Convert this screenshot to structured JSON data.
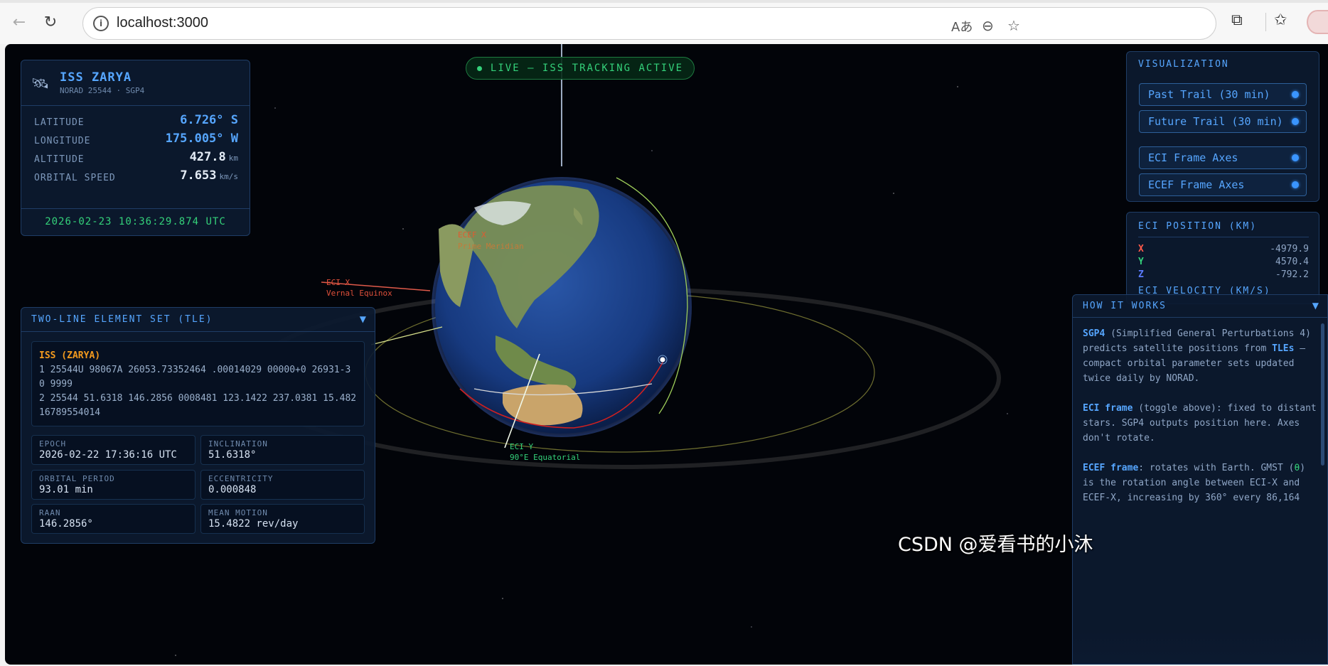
{
  "browser": {
    "url": "localhost:3000",
    "icons": [
      "back-icon",
      "reload-icon",
      "info-icon",
      "read-aloud-icon",
      "zoom-out-icon",
      "favorite-star-icon",
      "extensions-icon",
      "favorites-icon",
      "profile-avatar"
    ]
  },
  "iss": {
    "name": "ISS ZARYA",
    "subtitle": "NORAD 25544 · SGP4",
    "latitude_label": "LATITUDE",
    "latitude_value": "6.726° S",
    "longitude_label": "LONGITUDE",
    "longitude_value": "175.005° W",
    "altitude_label": "ALTITUDE",
    "altitude_value": "427.8",
    "altitude_unit": "km",
    "speed_label": "ORBITAL SPEED",
    "speed_value": "7.653",
    "speed_unit": "km/s",
    "timestamp": "2026-02-23 10:36:29.874 UTC",
    "colors": {
      "latlon": "#56a6ff",
      "plain": "#e4ecf6",
      "time": "#34d17a"
    }
  },
  "live_badge": "LIVE — ISS TRACKING ACTIVE",
  "scene_labels": {
    "ecef_x": "ECEF X",
    "ecef_x_sub": "Prime Meridian",
    "eci_x": "ECI X",
    "eci_x_sub": "Vernal Equinox",
    "eci_y": "ECI Y",
    "eci_y_sub": "90°E Equatorial"
  },
  "visualization": {
    "title": "VISUALIZATION",
    "toggles": [
      {
        "label": "Past Trail (30 min)",
        "on": true
      },
      {
        "label": "Future Trail (30 min)",
        "on": true
      },
      {
        "label": "ECI Frame Axes",
        "on": true
      },
      {
        "label": "ECEF Frame Axes",
        "on": true
      }
    ]
  },
  "eci_position": {
    "title": "ECI POSITION (KM)",
    "rows": [
      {
        "axis": "X",
        "value": "-4979.9",
        "color": "#ff5a4a"
      },
      {
        "axis": "Y",
        "value": "4570.4",
        "color": "#34d17a"
      },
      {
        "axis": "Z",
        "value": "-792.2",
        "color": "#5b7cff"
      }
    ],
    "velocity_title": "ECI VELOCITY (KM/S)"
  },
  "how_it_works": {
    "title": "HOW IT WORKS",
    "p1_kw": "SGP4",
    "p1_a": " (Simplified General Perturbations 4) predicts satellite positions from ",
    "p1_kw2": "TLEs",
    "p1_b": " — compact orbital parameter sets updated twice daily by NORAD.",
    "p2_kw": "ECI frame",
    "p2_a": " (toggle above): fixed to distant stars. SGP4 outputs position here. Axes don't rotate.",
    "p3_kw": "ECEF frame",
    "p3_a": ": rotates with Earth. GMST (",
    "p3_theta": "θ",
    "p3_b": ") is the rotation angle between ECI-X and ECEF-X, increasing by 360° every 86,164"
  },
  "tle": {
    "title": "TWO-LINE ELEMENT SET (TLE)",
    "name_line": "ISS (ZARYA)",
    "line1": "1 25544U 98067A   26053.73352464  .00014029  00000+0  26931-3 0  9999",
    "line2": "2 25544  51.6318 146.2856 0008481 123.1422 237.0381 15.48216789554014",
    "epoch_label": "EPOCH",
    "epoch_value": "2026-02-22 17:36:16 UTC",
    "inclination_label": "INCLINATION",
    "inclination_value": "51.6318°",
    "period_label": "ORBITAL PERIOD",
    "period_value": "93.01 min",
    "ecc_label": "ECCENTRICITY",
    "ecc_value": "0.000848",
    "raan_label": "RAAN",
    "raan_value": "146.2856°",
    "mm_label": "MEAN MOTION",
    "mm_value": "15.4822 rev/day"
  },
  "watermark": "CSDN @爱看书的小沐"
}
